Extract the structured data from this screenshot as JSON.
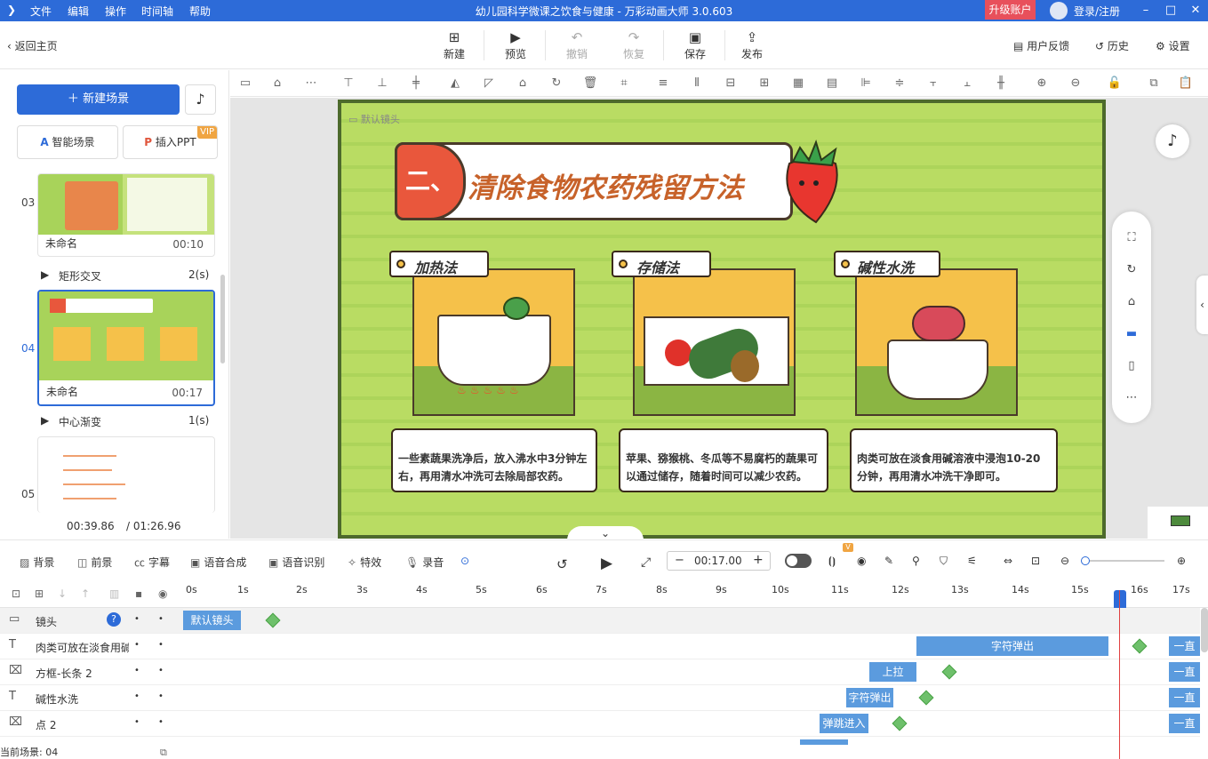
{
  "app": {
    "title": "幼儿园科学微课之饮食与健康 - 万彩动画大师 3.0.603"
  },
  "menu": [
    "文件",
    "编辑",
    "操作",
    "时间轴",
    "帮助"
  ],
  "account": {
    "upgrade": "升级账户",
    "login": "登录/注册"
  },
  "toolbar": {
    "back": "返回主页",
    "new": "新建",
    "preview": "预览",
    "undo": "撤销",
    "redo": "恢复",
    "save": "保存",
    "publish": "发布",
    "feedback": "用户反馈",
    "history": "历史",
    "settings": "设置"
  },
  "left": {
    "new_scene": "新建场景",
    "smart_scene": "智能场景",
    "insert_ppt": "插入PPT",
    "vip": "VIP",
    "scenes": [
      {
        "num": "03",
        "name": "未命名",
        "duration": "00:10"
      },
      {
        "num": "04",
        "name": "未命名",
        "duration": "00:17"
      },
      {
        "num": "05",
        "name": "",
        "duration": ""
      }
    ],
    "transitions": [
      {
        "name": "矩形交叉",
        "dur": "2(s)"
      },
      {
        "name": "中心渐变",
        "dur": "1(s)"
      }
    ],
    "current_time": "00:39.86",
    "total_time": "/ 01:26.96"
  },
  "stage": {
    "camera": "默认镜头",
    "heading_num": "二、",
    "heading": "清除食物农药残留方法",
    "panels": [
      {
        "title": "加热法",
        "text": "一些素蔬果洗净后，放入沸水中3分钟左右，再用清水冲洗可去除局部农药。"
      },
      {
        "title": "存储法",
        "text": "苹果、猕猴桃、冬瓜等不易腐朽的蔬果可以通过储存，随着时间可以减少农药。"
      },
      {
        "title": "碱性水洗",
        "text": "肉类可放在淡食用碱溶液中浸泡10-20分钟，再用清水冲洗干净即可。"
      }
    ]
  },
  "bottom": {
    "bg": "背景",
    "fg": "前景",
    "subtitle": "字幕",
    "tts": "语音合成",
    "asr": "语音识别",
    "fx": "特效",
    "record": "录音",
    "time": "00:17.00",
    "vip_badge": "V"
  },
  "timeline": {
    "ticks": [
      "0s",
      "1s",
      "2s",
      "3s",
      "4s",
      "5s",
      "6s",
      "7s",
      "8s",
      "9s",
      "10s",
      "11s",
      "12s",
      "13s",
      "14s",
      "15s",
      "16s",
      "17s"
    ],
    "tracks": [
      {
        "label": "镜头",
        "clip": "默认镜头",
        "type": "camera"
      },
      {
        "label": "肉类可放在淡食用碱",
        "clip": "字符弹出",
        "end": "一直"
      },
      {
        "label": "方框-长条 2",
        "clip": "上拉",
        "end": "一直"
      },
      {
        "label": "碱性水洗",
        "clip": "字符弹出",
        "end": "一直"
      },
      {
        "label": "点 2",
        "clip": "弹跳进入",
        "end": "一直"
      }
    ],
    "status": "当前场景: 04"
  }
}
